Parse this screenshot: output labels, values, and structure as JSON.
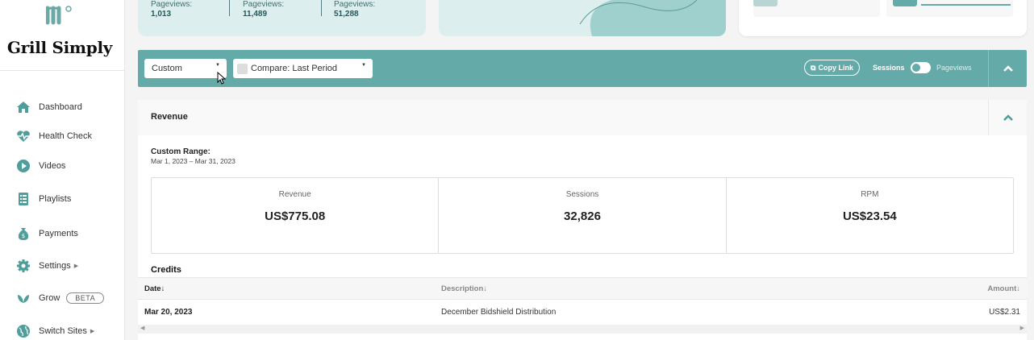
{
  "app": {
    "brand": "Grill Simply"
  },
  "sidebar": {
    "items": [
      {
        "label": "Dashboard",
        "icon": "home-icon"
      },
      {
        "label": "Health Check",
        "icon": "heartbeat-icon"
      },
      {
        "label": "Videos",
        "icon": "play-circle-icon"
      },
      {
        "label": "Playlists",
        "icon": "list-icon"
      },
      {
        "label": "Payments",
        "icon": "money-bag-icon"
      },
      {
        "label": "Settings",
        "icon": "gear-icon"
      },
      {
        "label": "Grow",
        "icon": "leaf-icon",
        "badge": "BETA"
      },
      {
        "label": "Switch Sites",
        "icon": "globe-icon"
      }
    ]
  },
  "top_stats": [
    {
      "title": "Pageviews:",
      "value": "1,013"
    },
    {
      "title": "Pageviews:",
      "value": "11,489"
    },
    {
      "title": "Pageviews:",
      "value": "51,288"
    }
  ],
  "toolbar": {
    "range_select": "Custom",
    "compare_select": "Compare: Last Period",
    "copy_link": "Copy Link",
    "toggle_left": "Sessions",
    "toggle_right": "Pageviews"
  },
  "revenue": {
    "title": "Revenue",
    "range_label": "Custom Range:",
    "range_value": "Mar 1, 2023 – Mar 31, 2023",
    "metrics": [
      {
        "label": "Revenue",
        "value": "US$775.08"
      },
      {
        "label": "Sessions",
        "value": "32,826"
      },
      {
        "label": "RPM",
        "value": "US$23.54"
      }
    ],
    "credits_title": "Credits",
    "table": {
      "headers": [
        "Date↓",
        "Description↓",
        "Amount↓"
      ],
      "rows": [
        {
          "date": "Mar 20, 2023",
          "description": "December Bidshield Distribution",
          "amount": "US$2.31"
        }
      ]
    }
  },
  "colors": {
    "accent": "#63aaa8",
    "light_card": "#dceeed",
    "icon": "#4f9e9b"
  }
}
